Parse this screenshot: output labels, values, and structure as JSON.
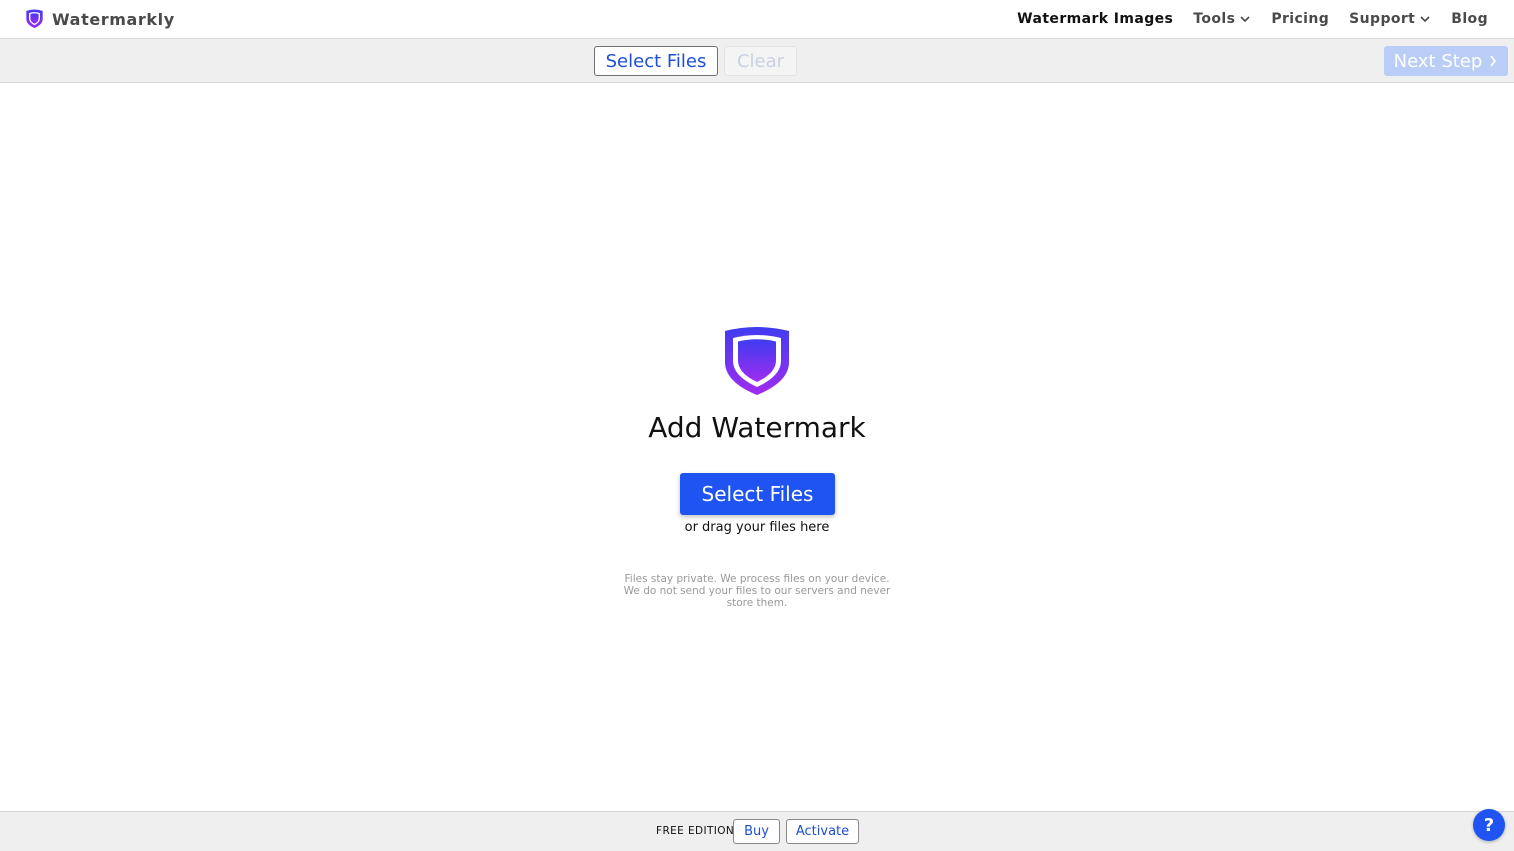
{
  "app": {
    "name": "Watermarkly",
    "brand_color": "#5b3cf0"
  },
  "nav": {
    "items": [
      {
        "label": "Watermark Images",
        "active": true,
        "dropdown": false
      },
      {
        "label": "Tools",
        "active": false,
        "dropdown": true
      },
      {
        "label": "Pricing",
        "active": false,
        "dropdown": false
      },
      {
        "label": "Support",
        "active": false,
        "dropdown": true
      },
      {
        "label": "Blog",
        "active": false,
        "dropdown": false
      }
    ]
  },
  "toolbar": {
    "select_label": "Select Files",
    "clear_label": "Clear",
    "next_label": "Next Step",
    "next_icon": "chevron-right-icon"
  },
  "main": {
    "title": "Add Watermark",
    "select_label": "Select Files",
    "drag_note": "or drag your files here",
    "privacy_note": "Files stay private. We process files on your device. We do not send your files to our servers and never store them."
  },
  "footer": {
    "edition_label": "FREE EDITION",
    "buy_label": "Buy",
    "activate_label": "Activate"
  },
  "help": {
    "label": "?"
  },
  "colors": {
    "primary": "#1f54f2",
    "link": "#1d4fd7",
    "disabled_next": "#b9cdf6"
  }
}
